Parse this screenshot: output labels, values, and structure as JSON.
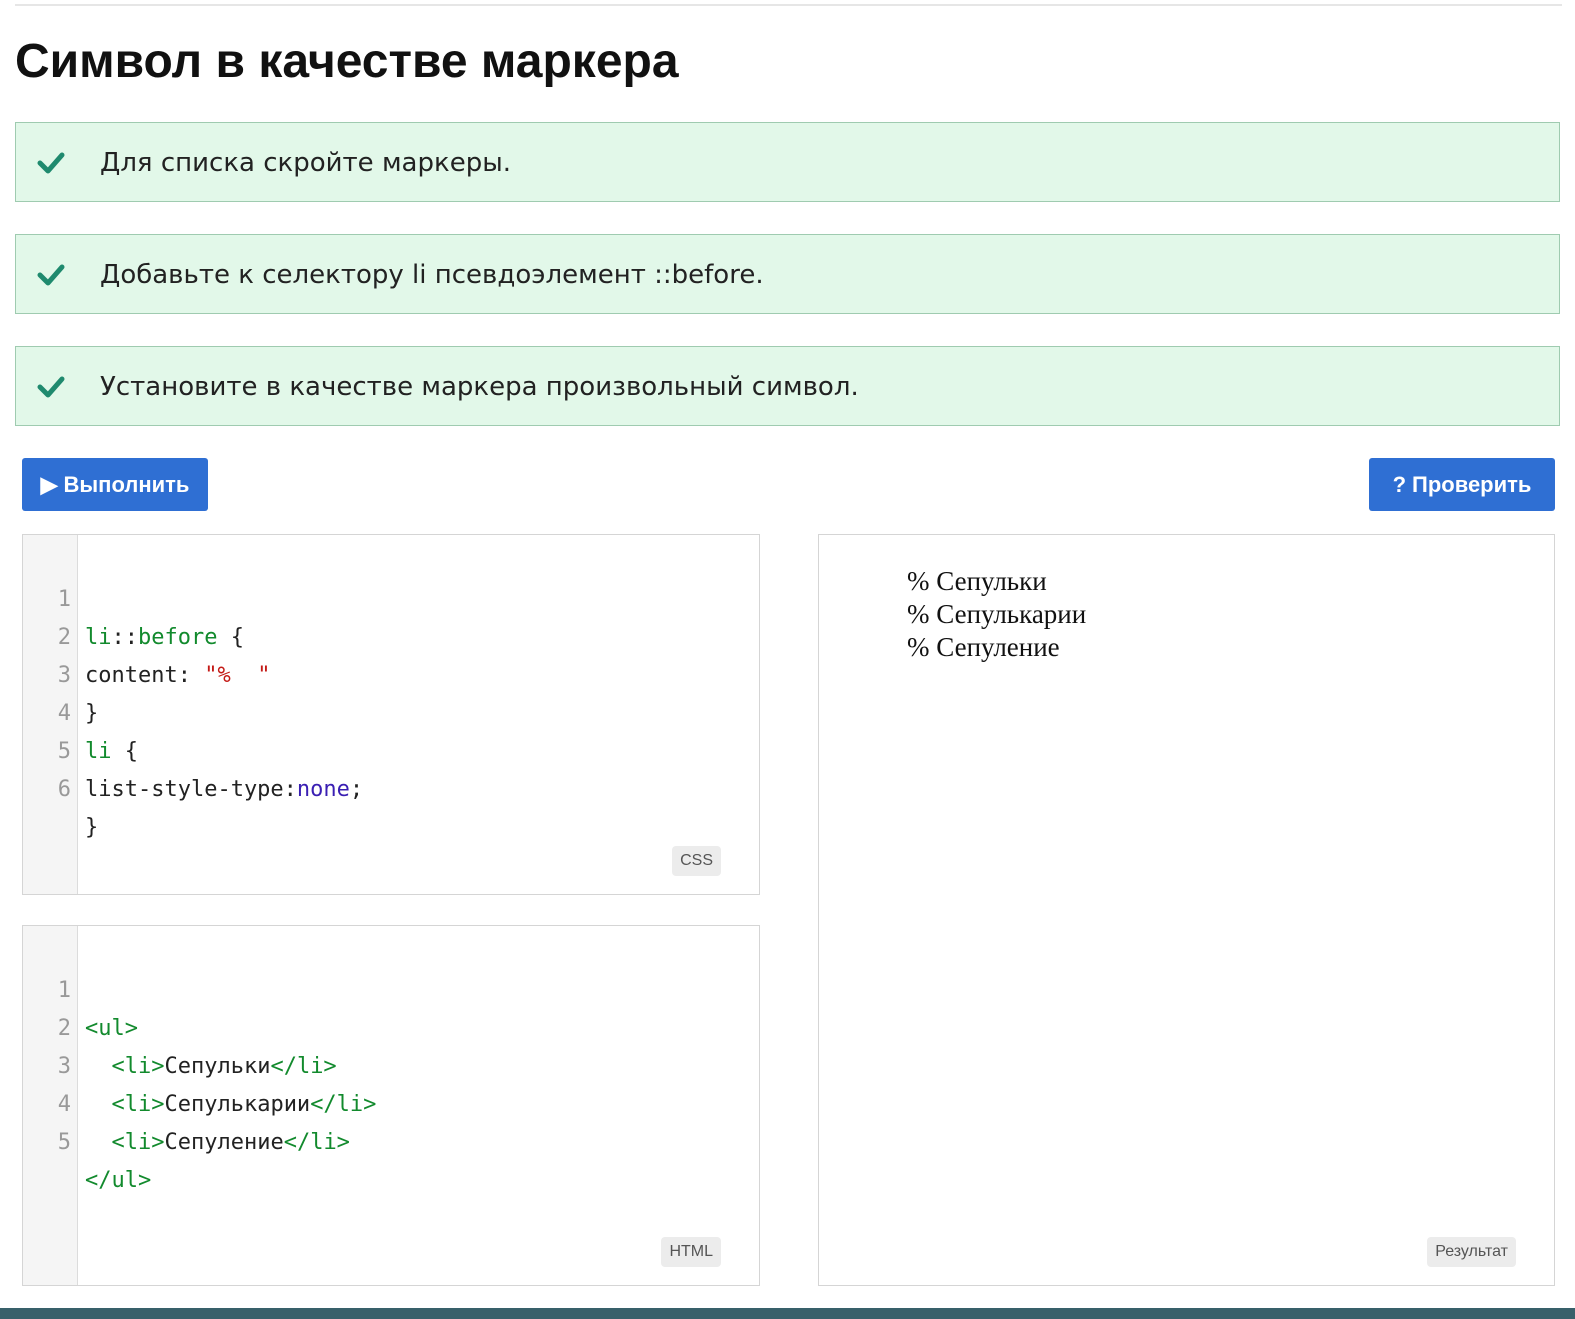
{
  "page": {
    "title": "Символ в качестве маркера"
  },
  "tasks": [
    {
      "text": "Для списка скройте маркеры.",
      "icon": "check-icon",
      "status": "done"
    },
    {
      "text": "Добавьте к селектору li псевдоэлемент ::before.",
      "icon": "check-icon",
      "status": "done"
    },
    {
      "text": "Установите в качестве маркера произвольный символ.",
      "icon": "check-icon",
      "status": "done"
    }
  ],
  "toolbar": {
    "run_label": "Выполнить",
    "run_icon": "play-icon",
    "check_label": "Проверить",
    "check_icon": "question-icon"
  },
  "css_editor": {
    "badge": "CSS",
    "line_numbers": [
      "1",
      "2",
      "3",
      "4",
      "5",
      "6"
    ],
    "lines": [
      "li::before {",
      "content: \"%  \"",
      "}",
      "li {",
      "list-style-type:none;",
      "}"
    ]
  },
  "html_editor": {
    "badge": "HTML",
    "line_numbers": [
      "1",
      "2",
      "3",
      "4",
      "5"
    ],
    "lines": [
      "<ul>",
      "  <li>Сепульки</li>",
      "  <li>Сепулькарии</li>",
      "  <li>Сепуление</li>",
      "</ul>"
    ]
  },
  "result": {
    "badge": "Результат",
    "items": [
      "% Сепульки",
      "% Сепулькарии",
      "% Сепуление"
    ]
  },
  "colors": {
    "task_bg": "#e2f8e9",
    "check": "#1f8a6e",
    "button": "#2f6fd3",
    "bottom_bar": "#38606a"
  }
}
